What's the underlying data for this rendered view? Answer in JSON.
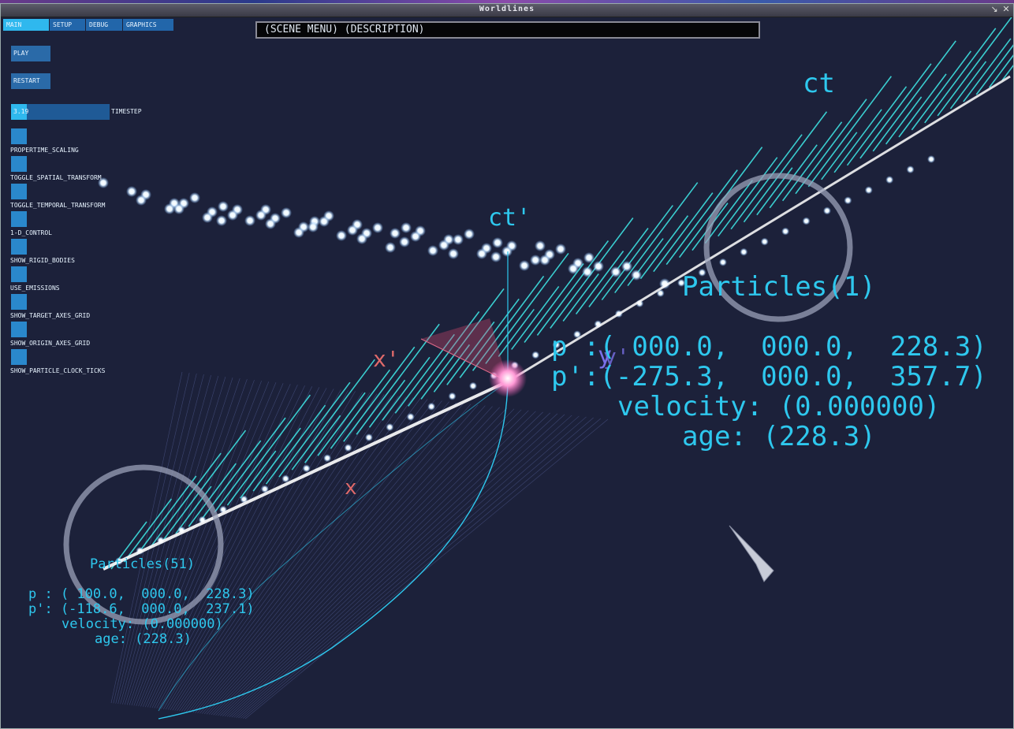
{
  "window": {
    "title": "Worldlines"
  },
  "tabs": [
    {
      "label": "MAIN",
      "active": true
    },
    {
      "label": "SETUP",
      "active": false
    },
    {
      "label": "DEBUG",
      "active": false
    },
    {
      "label": "GRAPHICS",
      "active": false
    }
  ],
  "description_bar": "(SCENE MENU) (DESCRIPTION)",
  "controls": {
    "play": "PLAY",
    "restart": "RESTART",
    "timestep": {
      "value": "3.19",
      "label": "TIMESTEP",
      "fill_fraction": 0.16
    },
    "toggles": [
      "PROPERTIME_SCALING",
      "TOGGLE_SPATIAL_TRANSFORM",
      "TOGGLE_TEMPORAL_TRANSFORM",
      "1-D_CONTROL",
      "SHOW_RIGID_BODIES",
      "USE_EMISSIONS",
      "SHOW_TARGET_AXES_GRID",
      "SHOW_ORIGIN_AXES_GRID",
      "SHOW_PARTICLE_CLOCK_TICKS"
    ]
  },
  "axes": {
    "ct_far": "ct",
    "ct_near": "ct'",
    "x": "x",
    "x_prime": "x'",
    "y": "y",
    "y_prime": "y'"
  },
  "particle_1": {
    "name": "Particles(1)",
    "p": "p :( 000.0,  000.0,  228.3)",
    "p_prime": "p':(-275.3,  000.0,  357.7)",
    "velocity": "velocity: (0.000000)",
    "age": "age: (228.3)"
  },
  "particle_51": {
    "name": "Particles(51)",
    "p": "p : ( 100.0,  000.0,  228.3)",
    "p_prime": "p': (-118.6,  000.0,  237.1)",
    "velocity": "velocity: (0.000000)",
    "age": "age: (228.3)"
  },
  "colors": {
    "background": "#1c213a",
    "accent": "#2ec8ee",
    "tab_active": "#2fb8ee",
    "button": "#2a6aa8",
    "axis_red": "#e06a6a"
  }
}
